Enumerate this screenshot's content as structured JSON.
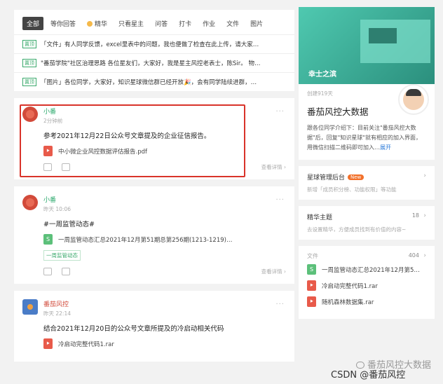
{
  "filters": [
    "全部",
    "等你回答",
    "精华",
    "只看星主",
    "问答",
    "打卡",
    "作业",
    "文件",
    "图片"
  ],
  "pinned_tag": "置顶",
  "pinned": [
    "「文件」有人同学反馈，excel里表中的问题，我也便做了检查在此上传，请大家…",
    "\"番茄学院\"社区治理思路 各位星友们，大家好，我是星主风控老表士，陈Sir。 物…",
    "「图片」各位同学，大家好，知识星球微信群已经开放🎉，会有同学陆续进群，…"
  ],
  "posts": [
    {
      "author": "小番",
      "time": "2分钟前",
      "text": "参考2021年12月22日公众号文章提及的企业征信报告。",
      "attachment": "中小微企业风控数据评估报告.pdf",
      "detail": "查看详情 ›"
    },
    {
      "author": "小番",
      "time": "昨天 10:06",
      "text": "#一周监管动态#",
      "attachment": "一周监管动态汇总2021年12月第51期总第256期(1213-1219)…",
      "hashtag": "一周监管动态",
      "detail": "查看详情 ›"
    },
    {
      "author": "番茄风控",
      "time": "昨天 22:14",
      "text": "结合2021年12月20日的公众号文章所提及的冷启动相关代码",
      "attachment": "冷启动完整代码1.rar"
    }
  ],
  "more_label": "···",
  "sidebar": {
    "banner_title": "幸士之滨",
    "created": "创建919天",
    "planet_name": "番茄风控大数据",
    "intro": "跟各位同学介绍下：目前关注\"番茄风控大数据\"后，回复\"知识星球\"就有相应的加入界面，用微信扫描二维码即可加入…",
    "expand": "展开",
    "admin_title": "星球管理后台",
    "new_badge": "New",
    "admin_sub": "新增「成员积分榜、功能权限」等功能",
    "digest_title": "精华主题",
    "digest_count": "18",
    "digest_sub": "去设置精华，方便成员找到有价值的内容~",
    "files_title": "文件",
    "files_count": "404",
    "files": [
      "一周监管动态汇总2021年12月第5…",
      "冷启动完整代码1.rar",
      "随机森林数据集.rar"
    ],
    "chev": "›"
  },
  "watermark": {
    "line1": "番茄风控大数据",
    "line2": "CSDN @番茄风控"
  },
  "colors": {
    "accent_green": "#39a96b",
    "highlight_red": "#d9332a",
    "link_blue": "#2a7ad8"
  }
}
